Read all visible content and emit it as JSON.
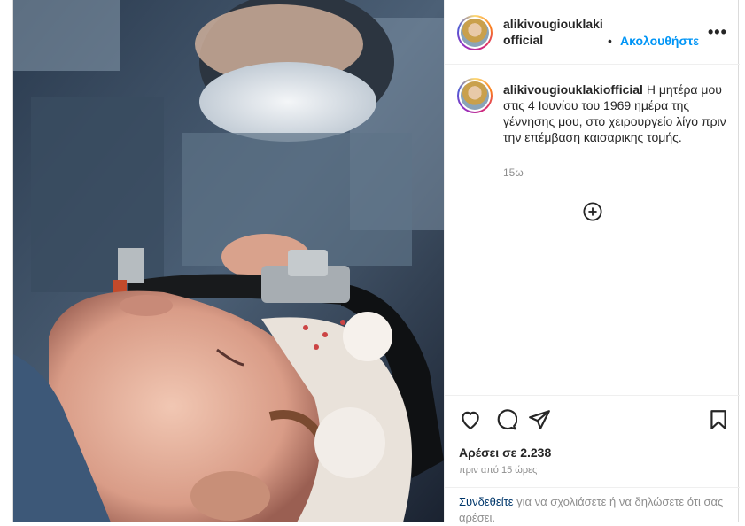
{
  "post": {
    "username": "alikivougiouklakiofficial",
    "username_line1": "alikivougiouklaki",
    "username_line2": "official",
    "separator": "•",
    "follow_label": "Ακολουθήστε",
    "more_label": "•••",
    "caption_username": "alikivougiouklakiofficial",
    "caption_text": "Η μητέρα μου στις 4 Ιουνίου του 1969 ημέρα της γέννησης μου, στο χειρουργείο λίγο πριν την επέμβαση καισαρικης τομής.",
    "caption_time": "15ω",
    "likes": "Αρέσει σε 2.238",
    "posted_ago": "πριν από 15 ώρες",
    "login_link": "Συνδεθείτε",
    "login_text": " για να σχολιάσετε ή να δηλώσετε ότι σας αρέσει."
  },
  "icons": {
    "like": "heart-icon",
    "comment": "comment-icon",
    "share": "paper-plane-icon",
    "save": "bookmark-icon",
    "load_more": "plus-circle-icon",
    "options": "more-icon"
  },
  "colors": {
    "follow_blue": "#0095f6",
    "link_dark": "#00376b",
    "muted": "#8e8e8e"
  }
}
